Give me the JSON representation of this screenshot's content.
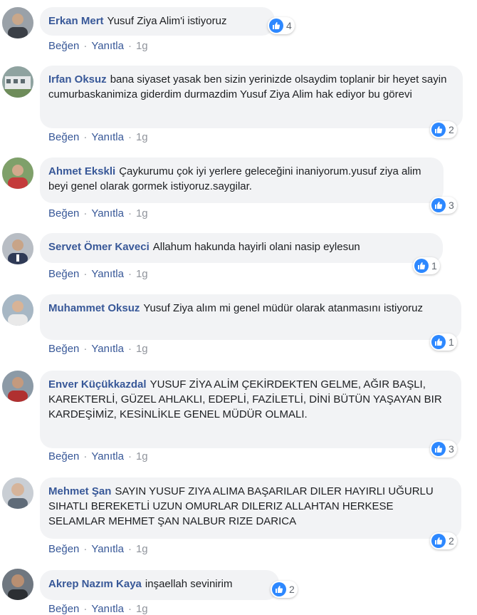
{
  "ui": {
    "like_action": "Beğen",
    "reply_action": "Yanıtla",
    "separator": "·"
  },
  "comments": [
    {
      "author": "Erkan Mert",
      "text": "Yusuf Ziya Alim'i istiyoruz",
      "likes": "4",
      "time": "1g"
    },
    {
      "author": "Irfan Oksuz",
      "text": "bana siyaset yasak ben sizin yerinizde olsaydim toplanir bir heyet sayin cumurbaskanimiza giderdim durmazdim Yusuf Ziya Alim hak ediyor bu görevi",
      "likes": "2",
      "time": "1g"
    },
    {
      "author": "Ahmet Ekskli",
      "text": "Çaykurumu çok iyi yerlere geleceğini inaniyorum.yusuf ziya alim beyi genel olarak gormek istiyoruz.saygilar.",
      "likes": "3",
      "time": "1g"
    },
    {
      "author": "Servet Ömer Kaveci",
      "text": "Allahum hakunda hayirli olani nasip eylesun",
      "likes": "1",
      "time": "1g"
    },
    {
      "author": "Muhammet Oksuz",
      "text": "Yusuf Ziya alım mi genel müdür olarak atanmasını istiyoruz",
      "likes": "1",
      "time": "1g"
    },
    {
      "author": "Enver Küçükkazdal",
      "text": "YUSUF ZİYA ALİM ÇEKİRDEKTEN GELME, AĞIR BAŞLI, KAREKTERLİ, GÜZEL AHLAKLI, EDEPLİ, FAZİLETLİ, DİNİ BÜTÜN YAŞAYAN BIR KARDEŞİMİZ, KESİNLİKLE GENEL MÜDÜR OLMALI.",
      "likes": "3",
      "time": "1g"
    },
    {
      "author": "Mehmet Şan",
      "text": "SAYIN YUSUF ZIYA ALIMA BAŞARILAR DILER HAYIRLI UĞURLU SIHATLI BEREKETLİ UZUN OMURLAR DILERIZ ALLAHTAN HERKESE SELAMLAR MEHMET ŞAN NALBUR RIZE DARICA",
      "likes": "2",
      "time": "1g"
    },
    {
      "author": "Akrep Nazım Kaya",
      "text": "inşaellah sevinirim",
      "likes": "2",
      "time": "1g"
    }
  ],
  "colors": {
    "author": "#385898",
    "bubble": "#f2f3f5",
    "like_badge": "#2d88ff",
    "meta": "#90949c"
  },
  "icons": {
    "like": "thumbs-up-icon",
    "avatar": "profile-photo"
  }
}
